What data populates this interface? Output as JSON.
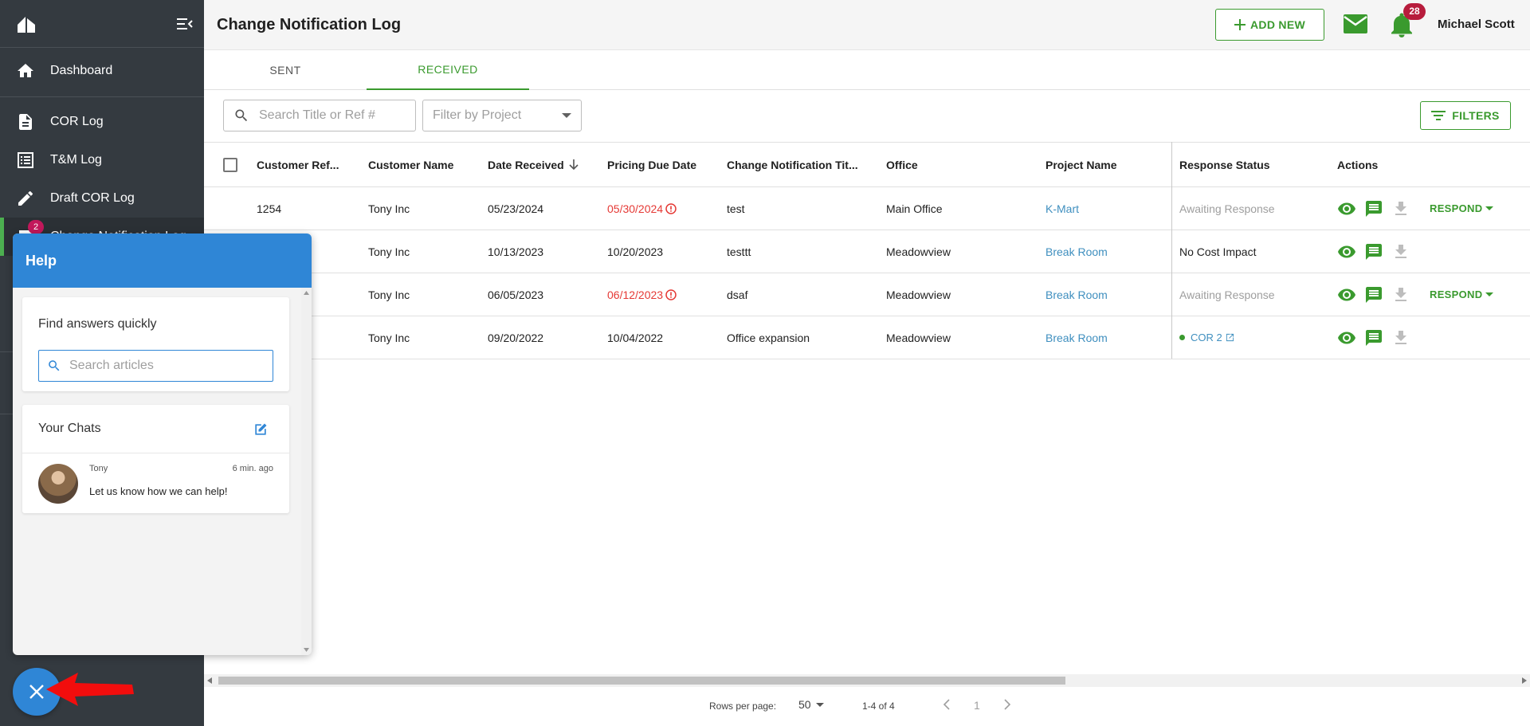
{
  "header": {
    "title": "Change Notification Log",
    "add_new_label": "ADD NEW",
    "notification_count": "28",
    "user_name": "Michael Scott"
  },
  "sidebar": {
    "items": [
      {
        "label": "Dashboard",
        "icon": "home-icon"
      },
      {
        "label": "COR Log",
        "icon": "document-icon"
      },
      {
        "label": "T&M Log",
        "icon": "list-icon"
      },
      {
        "label": "Draft COR Log",
        "icon": "pencil-icon"
      },
      {
        "label": "Change Notification Log",
        "icon": "notification-icon",
        "badge": "2",
        "active": true
      }
    ]
  },
  "tabs": [
    {
      "label": "SENT"
    },
    {
      "label": "RECEIVED",
      "active": true
    }
  ],
  "toolbar": {
    "search_placeholder": "Search Title or Ref #",
    "filter_project_placeholder": "Filter by Project",
    "filters_label": "FILTERS"
  },
  "table": {
    "columns": [
      "Customer Ref...",
      "Customer Name",
      "Date Received",
      "Pricing Due Date",
      "Change Notification Tit...",
      "Office",
      "Project Name",
      "Response Status",
      "Actions"
    ],
    "rows": [
      {
        "ref": "1254",
        "customer": "Tony Inc",
        "received": "05/23/2024",
        "due": "05/30/2024",
        "overdue": true,
        "title": "test",
        "office": "Main Office",
        "project": "K-Mart",
        "status": "Awaiting Response",
        "status_type": "awaiting",
        "respond": "RESPOND"
      },
      {
        "ref": "",
        "customer": "Tony Inc",
        "received": "10/13/2023",
        "due": "10/20/2023",
        "overdue": false,
        "title": "testtt",
        "office": "Meadowview",
        "project": "Break Room",
        "status": "No Cost Impact",
        "status_type": "normal",
        "respond": ""
      },
      {
        "ref": "",
        "customer": "Tony Inc",
        "received": "06/05/2023",
        "due": "06/12/2023",
        "overdue": true,
        "title": "dsaf",
        "office": "Meadowview",
        "project": "Break Room",
        "status": "Awaiting Response",
        "status_type": "awaiting",
        "respond": "RESPOND"
      },
      {
        "ref": "",
        "customer": "Tony Inc",
        "received": "09/20/2022",
        "due": "10/04/2022",
        "overdue": false,
        "title": "Office expansion",
        "office": "Meadowview",
        "project": "Break Room",
        "status": "COR 2",
        "status_type": "cor",
        "respond": ""
      }
    ]
  },
  "pagination": {
    "rows_per_page_label": "Rows per page:",
    "rows_per_page": "50",
    "range": "1-4 of 4",
    "page": "1"
  },
  "help": {
    "title": "Help",
    "find_answers": "Find answers quickly",
    "search_placeholder": "Search articles",
    "your_chats": "Your Chats",
    "chat": {
      "author": "Tony",
      "time": "6 min. ago",
      "message": "Let us know how we can help!"
    }
  },
  "colors": {
    "accent": "#3a9a2e",
    "sidebar": "#343a40",
    "help_blue": "#2f86d6",
    "overdue": "#e53935",
    "badge": "#b71c3c"
  }
}
